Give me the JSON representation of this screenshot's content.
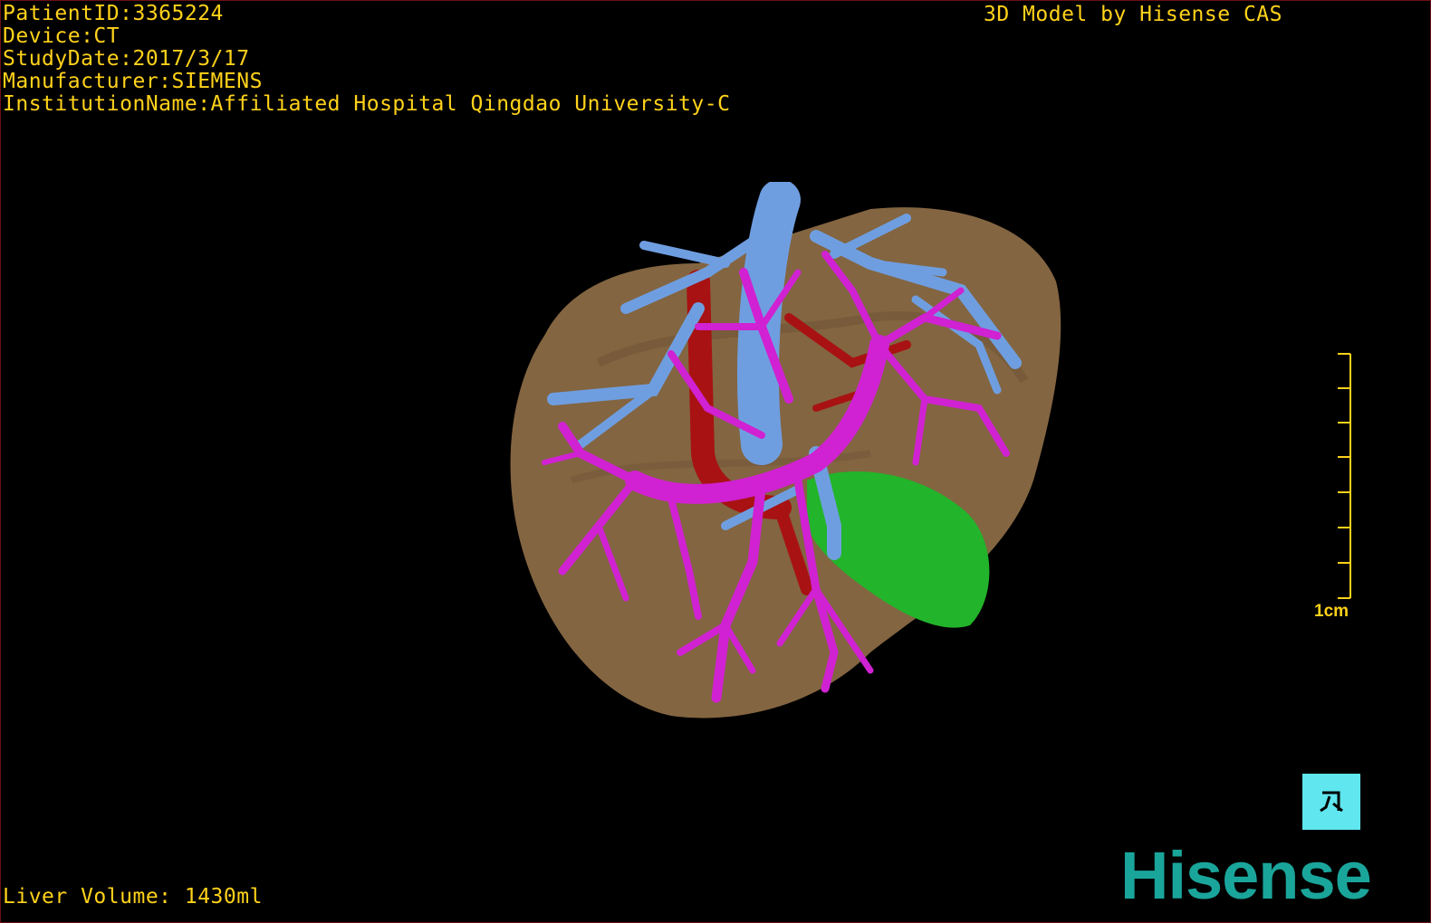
{
  "overlay": {
    "patient_id": "PatientID:3365224",
    "device": "Device:CT",
    "study_date": "StudyDate:2017/3/17",
    "manufacturer": "Manufacturer:SIEMENS",
    "institution": "InstitutionName:Affiliated Hospital Qingdao University-C",
    "title": "3D Model by Hisense CAS",
    "liver_volume": "Liver Volume: 1430ml"
  },
  "scale_bar": {
    "label": "1cm"
  },
  "logo": {
    "text": "Hisense"
  },
  "colors": {
    "overlay_text": "#ffd21a",
    "liver": "#8a6a44",
    "portal_vein": "#d021d2",
    "hepatic_vein": "#6f9ee0",
    "artery": "#a81212",
    "gallbladder": "#22b42a",
    "logo": "#1aa59b",
    "tool_button": "#5fe6ee"
  },
  "icons": {
    "tool_button": "rotate-tool-icon"
  }
}
